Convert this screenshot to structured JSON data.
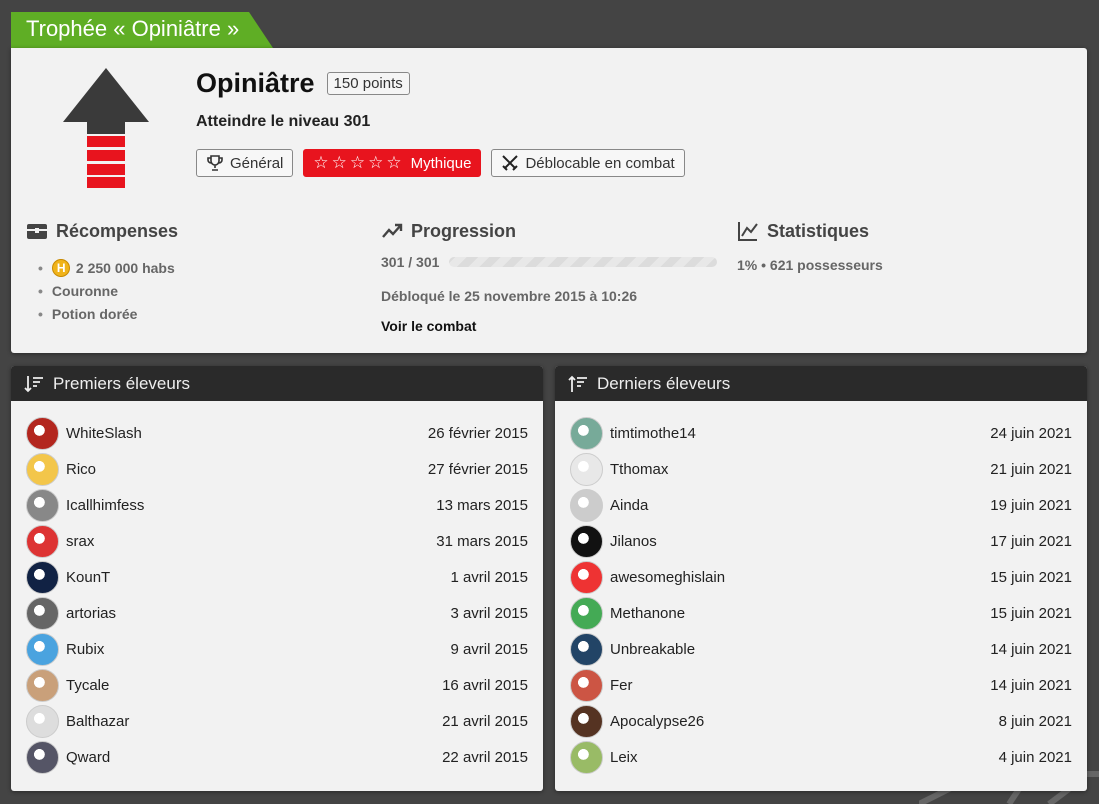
{
  "page_title": "Trophée « Opiniâtre »",
  "trophy": {
    "name": "Opiniâtre",
    "points": "150 points",
    "description": "Atteindre le niveau 301",
    "tags": {
      "category": "Général",
      "rarity_stars": "☆☆☆☆☆",
      "rarity": "Mythique",
      "unlock": "Déblocable en combat"
    }
  },
  "rewards": {
    "title": "Récompenses",
    "items": [
      "2 250 000 habs",
      "Couronne",
      "Potion dorée"
    ]
  },
  "progression": {
    "title": "Progression",
    "value": "301 / 301",
    "progress": 1.0,
    "unlocked": "Débloqué le 25 novembre 2015 à 10:26",
    "link": "Voir le combat"
  },
  "statistics": {
    "title": "Statistiques",
    "line": "1% • 621 possesseurs"
  },
  "first": {
    "title": "Premiers éleveurs",
    "rows": [
      {
        "name": "WhiteSlash",
        "date": "26 février 2015"
      },
      {
        "name": "Rico",
        "date": "27 février 2015"
      },
      {
        "name": "Icallhimfess",
        "date": "13 mars 2015"
      },
      {
        "name": "srax",
        "date": "31 mars 2015"
      },
      {
        "name": "KounT",
        "date": "1 avril 2015"
      },
      {
        "name": "artorias",
        "date": "3 avril 2015"
      },
      {
        "name": "Rubix",
        "date": "9 avril 2015"
      },
      {
        "name": "Tycale",
        "date": "16 avril 2015"
      },
      {
        "name": "Balthazar",
        "date": "21 avril 2015"
      },
      {
        "name": "Qward",
        "date": "22 avril 2015"
      }
    ]
  },
  "last": {
    "title": "Derniers éleveurs",
    "rows": [
      {
        "name": "timtimothe14",
        "date": "24 juin 2021"
      },
      {
        "name": "Tthomax",
        "date": "21 juin 2021"
      },
      {
        "name": "Ainda",
        "date": "19 juin 2021"
      },
      {
        "name": "Jilanos",
        "date": "17 juin 2021"
      },
      {
        "name": "awesomeghislain",
        "date": "15 juin 2021"
      },
      {
        "name": "Methanone",
        "date": "15 juin 2021"
      },
      {
        "name": "Unbreakable",
        "date": "14 juin 2021"
      },
      {
        "name": "Fer",
        "date": "14 juin 2021"
      },
      {
        "name": "Apocalypse26",
        "date": "8 juin 2021"
      },
      {
        "name": "Leix",
        "date": "4 juin 2021"
      }
    ]
  },
  "colors": {
    "title_green": "#5fae25",
    "rarity_red": "#e8141e",
    "panel_header": "#2a2a2a"
  }
}
